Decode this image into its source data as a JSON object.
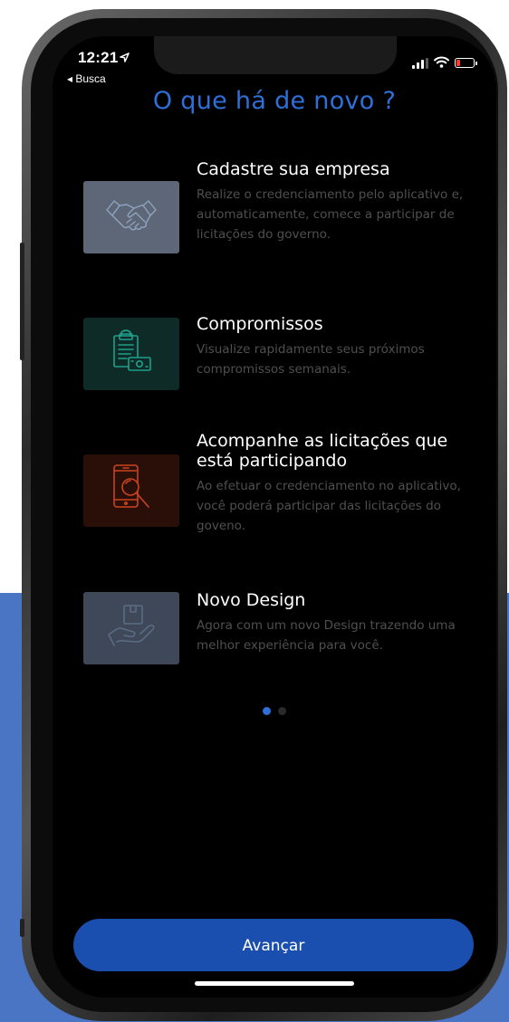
{
  "colors": {
    "page_accent_bg": "#4a74c4",
    "title": "#2e6fd8",
    "button": "#1a4fb0",
    "dot_active": "#2e6fd8",
    "dot_inactive": "#2a2a2a"
  },
  "status_bar": {
    "time": "12:21",
    "location_icon": "location-arrow-icon",
    "back_label": "◂ Busca",
    "icons": [
      "cellular-signal-icon",
      "wifi-icon",
      "battery-low-icon"
    ]
  },
  "screen": {
    "title": "O que há de novo ?"
  },
  "features": [
    {
      "title": "Cadastre sua empresa",
      "description": "Realize o credenciamento pelo aplicativo e, automaticamente, comece a participar de licitações do governo.",
      "icon": "handshake-icon",
      "icon_bg": "#5d6778",
      "icon_color": "#8fa2c0"
    },
    {
      "title": "Compromissos",
      "description": "Visualize rapidamente seus próximos compromissos semanais.",
      "icon": "clipboard-money-icon",
      "icon_bg": "#0f2b28",
      "icon_color": "#1fa08a"
    },
    {
      "title": "Acompanhe as licitações que está participando",
      "description": "Ao efetuar o credenciamento no aplicativo, você poderá participar das licitações do goveno.",
      "icon": "phone-search-icon",
      "icon_bg": "#2a0f09",
      "icon_color": "#c9431e"
    },
    {
      "title": "Novo Design",
      "description": "Agora com um novo Design trazendo uma melhor experiência para você.",
      "icon": "hand-box-icon",
      "icon_bg": "#3e4858",
      "icon_color": "#5b6b85"
    }
  ],
  "pagination": {
    "total": 2,
    "active": 1
  },
  "actions": {
    "next_label": "Avançar"
  }
}
